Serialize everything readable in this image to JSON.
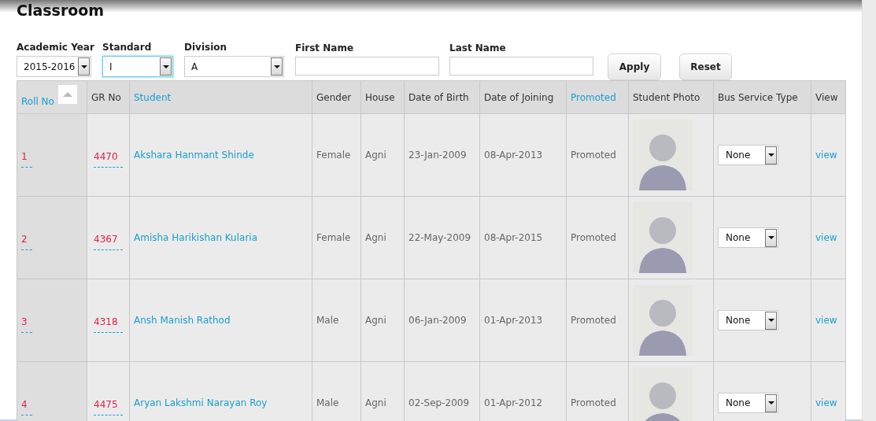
{
  "page": {
    "title": "Classroom"
  },
  "filters": [
    {
      "label": "Academic Year",
      "kind": "select",
      "value": "2015-2016",
      "focused": false
    },
    {
      "label": "Standard",
      "kind": "select",
      "value": "I",
      "focused": true
    },
    {
      "label": "Division",
      "kind": "select",
      "value": "A",
      "focused": false
    },
    {
      "label": "First Name",
      "kind": "text",
      "focused": false
    },
    {
      "label": "Last Name",
      "kind": "text",
      "focused": false
    }
  ],
  "buttons": [
    "Apply",
    "Reset"
  ],
  "table": {
    "columns": [
      {
        "label": "Roll No",
        "sortable": true,
        "sorted": true
      },
      {
        "label": "GR No",
        "sortable": false,
        "sorted": false
      },
      {
        "label": "Student",
        "sortable": true,
        "sorted": false
      },
      {
        "label": "Gender",
        "sortable": false,
        "sorted": false
      },
      {
        "label": "House",
        "sortable": false,
        "sorted": false
      },
      {
        "label": "Date of Birth",
        "sortable": false,
        "sorted": false
      },
      {
        "label": "Date of Joining",
        "sortable": false,
        "sorted": false
      },
      {
        "label": "Promoted",
        "sortable": true,
        "sorted": false
      },
      {
        "label": "Student Photo",
        "sortable": false,
        "sorted": false
      },
      {
        "label": "Bus Service Type",
        "sortable": false,
        "sorted": false
      },
      {
        "label": "View",
        "sortable": false,
        "sorted": false
      }
    ],
    "rows": [
      {
        "roll_no": "1",
        "gr_no": "4470",
        "student": "Akshara Hanmant Shinde",
        "gender": "Female",
        "house": "Agni",
        "date_of_birth": "23-Jan-2009",
        "date_of_joining": "08-Apr-2013",
        "promoted": "Promoted",
        "bus_service_type": "None",
        "view": "view"
      },
      {
        "roll_no": "2",
        "gr_no": "4367",
        "student": "Amisha Harikishan Kularia",
        "gender": "Female",
        "house": "Agni",
        "date_of_birth": "22-May-2009",
        "date_of_joining": "08-Apr-2015",
        "promoted": "Promoted",
        "bus_service_type": "None",
        "view": "view"
      },
      {
        "roll_no": "3",
        "gr_no": "4318",
        "student": "Ansh Manish Rathod",
        "gender": "Male",
        "house": "Agni",
        "date_of_birth": "06-Jan-2009",
        "date_of_joining": "01-Apr-2013",
        "promoted": "Promoted",
        "bus_service_type": "None",
        "view": "view"
      },
      {
        "roll_no": "4",
        "gr_no": "4475",
        "student": "Aryan Lakshmi Narayan Roy",
        "gender": "Male",
        "house": "Agni",
        "date_of_birth": "02-Sep-2009",
        "date_of_joining": "01-Apr-2012",
        "promoted": "Promoted",
        "bus_service_type": "None",
        "view": "view"
      }
    ]
  }
}
